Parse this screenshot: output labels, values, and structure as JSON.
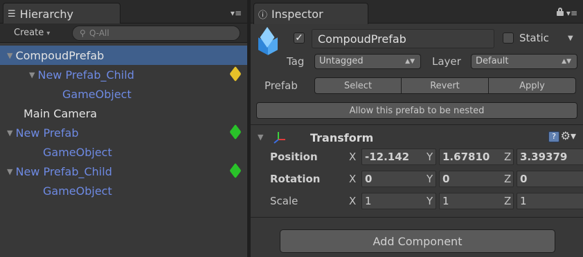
{
  "hierarchy": {
    "tab_label": "Hierarchy",
    "tab_icon": "list-icon",
    "create_label": "Create",
    "search_placeholder": "Q-All",
    "items": [
      {
        "label": "CompoudPrefab",
        "color": "white",
        "selected": true,
        "expanded": true,
        "prefab_badge": null
      },
      {
        "label": "New Prefab_Child",
        "color": "blue",
        "selected": false,
        "expanded": true,
        "prefab_badge": "#e6c229"
      },
      {
        "label": "GameObject",
        "color": "blue",
        "selected": false,
        "expanded": false,
        "prefab_badge": null
      },
      {
        "label": "Main Camera",
        "color": "white",
        "selected": false,
        "expanded": false,
        "prefab_badge": null
      },
      {
        "label": "New Prefab",
        "color": "blue",
        "selected": false,
        "expanded": true,
        "prefab_badge": "#29c229"
      },
      {
        "label": "GameObject",
        "color": "blue",
        "selected": false,
        "expanded": false,
        "prefab_badge": null
      },
      {
        "label": "New Prefab_Child",
        "color": "blue",
        "selected": false,
        "expanded": true,
        "prefab_badge": "#29c229"
      },
      {
        "label": "GameObject",
        "color": "blue",
        "selected": false,
        "expanded": false,
        "prefab_badge": null
      }
    ]
  },
  "inspector": {
    "tab_label": "Inspector",
    "tab_icon": "info-icon",
    "object_name": "CompoudPrefab",
    "active_checked": true,
    "static_label": "Static",
    "tag_label": "Tag",
    "tag_value": "Untagged",
    "layer_label": "Layer",
    "layer_value": "Default",
    "prefab_label": "Prefab",
    "prefab_buttons": {
      "select": "Select",
      "revert": "Revert",
      "apply": "Apply"
    },
    "nested_button": "Allow this prefab to be nested",
    "transform": {
      "title": "Transform",
      "position": {
        "label": "Position",
        "x": "-12.142",
        "y": "1.67810",
        "z": "3.39379"
      },
      "rotation": {
        "label": "Rotation",
        "x": "0",
        "y": "0",
        "z": "0"
      },
      "scale": {
        "label": "Scale",
        "x": "1",
        "y": "1",
        "z": "1"
      }
    },
    "add_component": "Add Component"
  },
  "colors": {
    "selection": "#3f5f8c",
    "prefab_text": "#6e8ae3"
  }
}
